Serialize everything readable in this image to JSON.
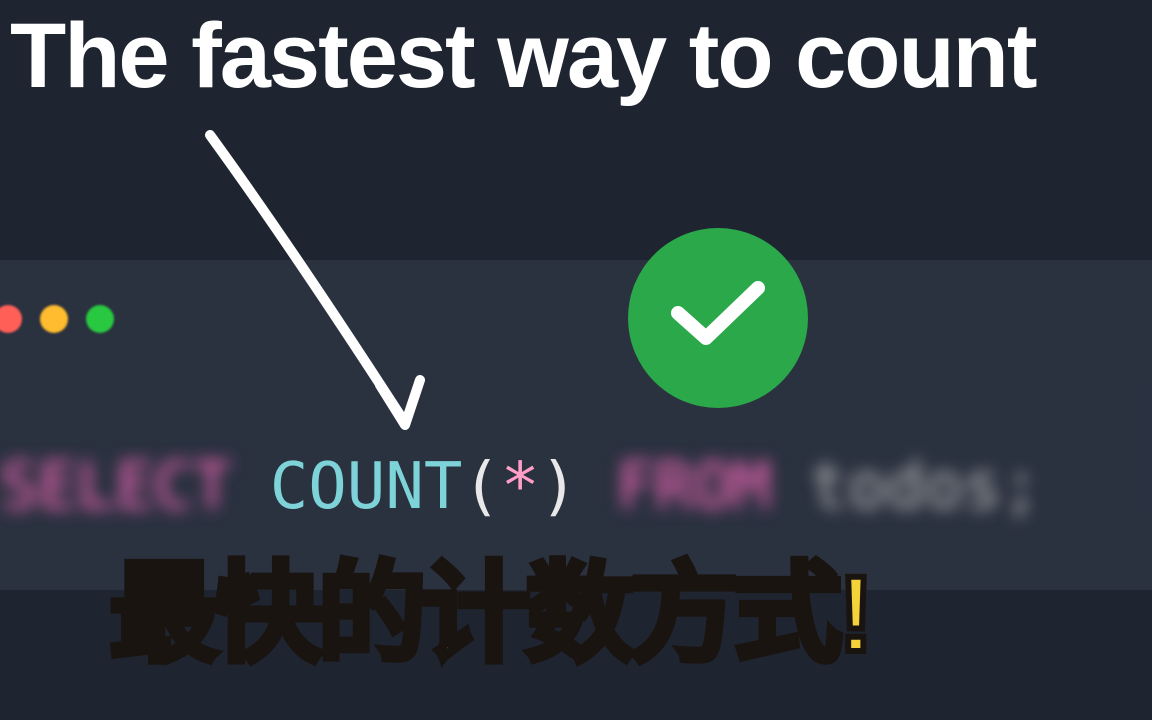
{
  "header": {
    "title_en": "The fastest way to count"
  },
  "code": {
    "keyword_select": "SELECT",
    "function_count": "COUNT",
    "paren_open": "(",
    "star": "*",
    "paren_close": ")",
    "keyword_from": "FROM",
    "table_name": "todos",
    "semicolon": ";"
  },
  "footer": {
    "title_cn": "最快的计数方式!"
  }
}
